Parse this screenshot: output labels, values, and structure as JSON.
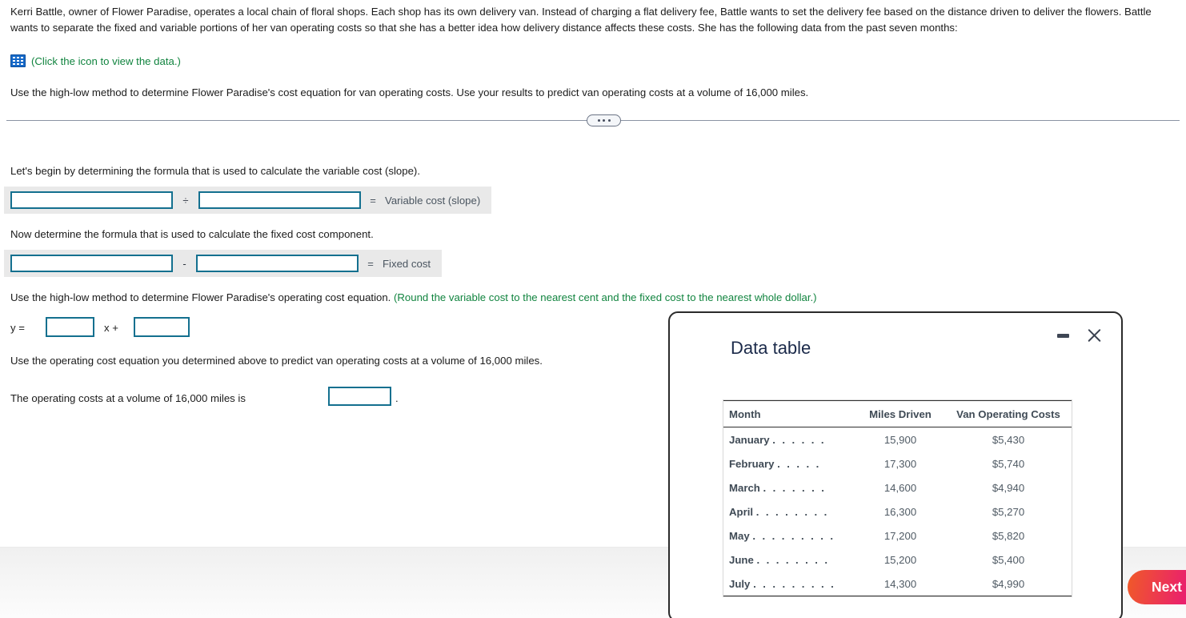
{
  "problem": {
    "statement": "Kerri Battle, owner of Flower Paradise, operates a local chain of floral shops. Each shop has its own delivery van. Instead of charging a flat delivery fee, Battle wants to set the delivery fee based on the distance driven to deliver the flowers. Battle wants to separate the fixed and variable portions of her van operating costs so that she has a better idea how delivery distance affects these costs. She has the following data from the past seven months:",
    "data_icon_name": "table-grid-icon",
    "data_icon_text": "(Click the icon to view the data.)",
    "instruction": "Use the high-low method to determine Flower Paradise's cost equation for van operating costs. Use your results to predict van operating costs at a volume of 16,000 miles."
  },
  "work": {
    "step1_prompt": "Let's begin by determining the formula that is used to calculate the variable cost (slope).",
    "step1_numerator_value": "",
    "step1_denominator_value": "",
    "step1_operator": "÷",
    "step1_equals": "=",
    "step1_result_label": "Variable cost (slope)",
    "step2_prompt": "Now determine the formula that is used to calculate the fixed cost component.",
    "step2_left_value": "",
    "step2_right_value": "",
    "step2_operator": "-",
    "step2_equals": "=",
    "step2_result_label": "Fixed cost",
    "step3_prompt": "Use the high-low method to determine Flower Paradise's operating cost equation.",
    "step3_hint": "(Round the variable cost to the nearest cent and the fixed cost to the nearest whole dollar.)",
    "equation_y_label": "y =",
    "equation_slope_value": "",
    "equation_x_label": "x +",
    "equation_intercept_value": "",
    "step4_prompt": "Use the operating cost equation you determined above to predict van operating costs at a volume of 16,000 miles.",
    "answer_prefix": "The operating costs at a volume of 16,000 miles is",
    "answer_value": "",
    "answer_suffix": "."
  },
  "dialog": {
    "title": "Data table",
    "minimize_icon": "minimize-icon",
    "close_icon": "close-icon",
    "columns": [
      "Month",
      "Miles Driven",
      "Van Operating Costs"
    ],
    "rows": [
      {
        "month": "January",
        "dots": ". . . . . .",
        "miles": "15,900",
        "cost": "$5,430"
      },
      {
        "month": "February",
        "dots": ". . . . .",
        "miles": "17,300",
        "cost": "$5,740"
      },
      {
        "month": "March",
        "dots": ". . . . . . .",
        "miles": "14,600",
        "cost": "$4,940"
      },
      {
        "month": "April",
        "dots": ". . . . . . . .",
        "miles": "16,300",
        "cost": "$5,270"
      },
      {
        "month": "May",
        "dots": ". . . . . . . . .",
        "miles": "17,200",
        "cost": "$5,820"
      },
      {
        "month": "June",
        "dots": ". . . . . . . .",
        "miles": "15,200",
        "cost": "$5,400"
      },
      {
        "month": "July",
        "dots": ". . . . . . . . .",
        "miles": "14,300",
        "cost": "$4,990"
      }
    ]
  },
  "footer": {
    "next_label": "Next"
  },
  "colors": {
    "input_border": "#14708f",
    "hint_green": "#11843f",
    "icon_blue": "#1669c8",
    "next_gradient_from": "#f05a28",
    "next_gradient_to": "#e5177a"
  }
}
